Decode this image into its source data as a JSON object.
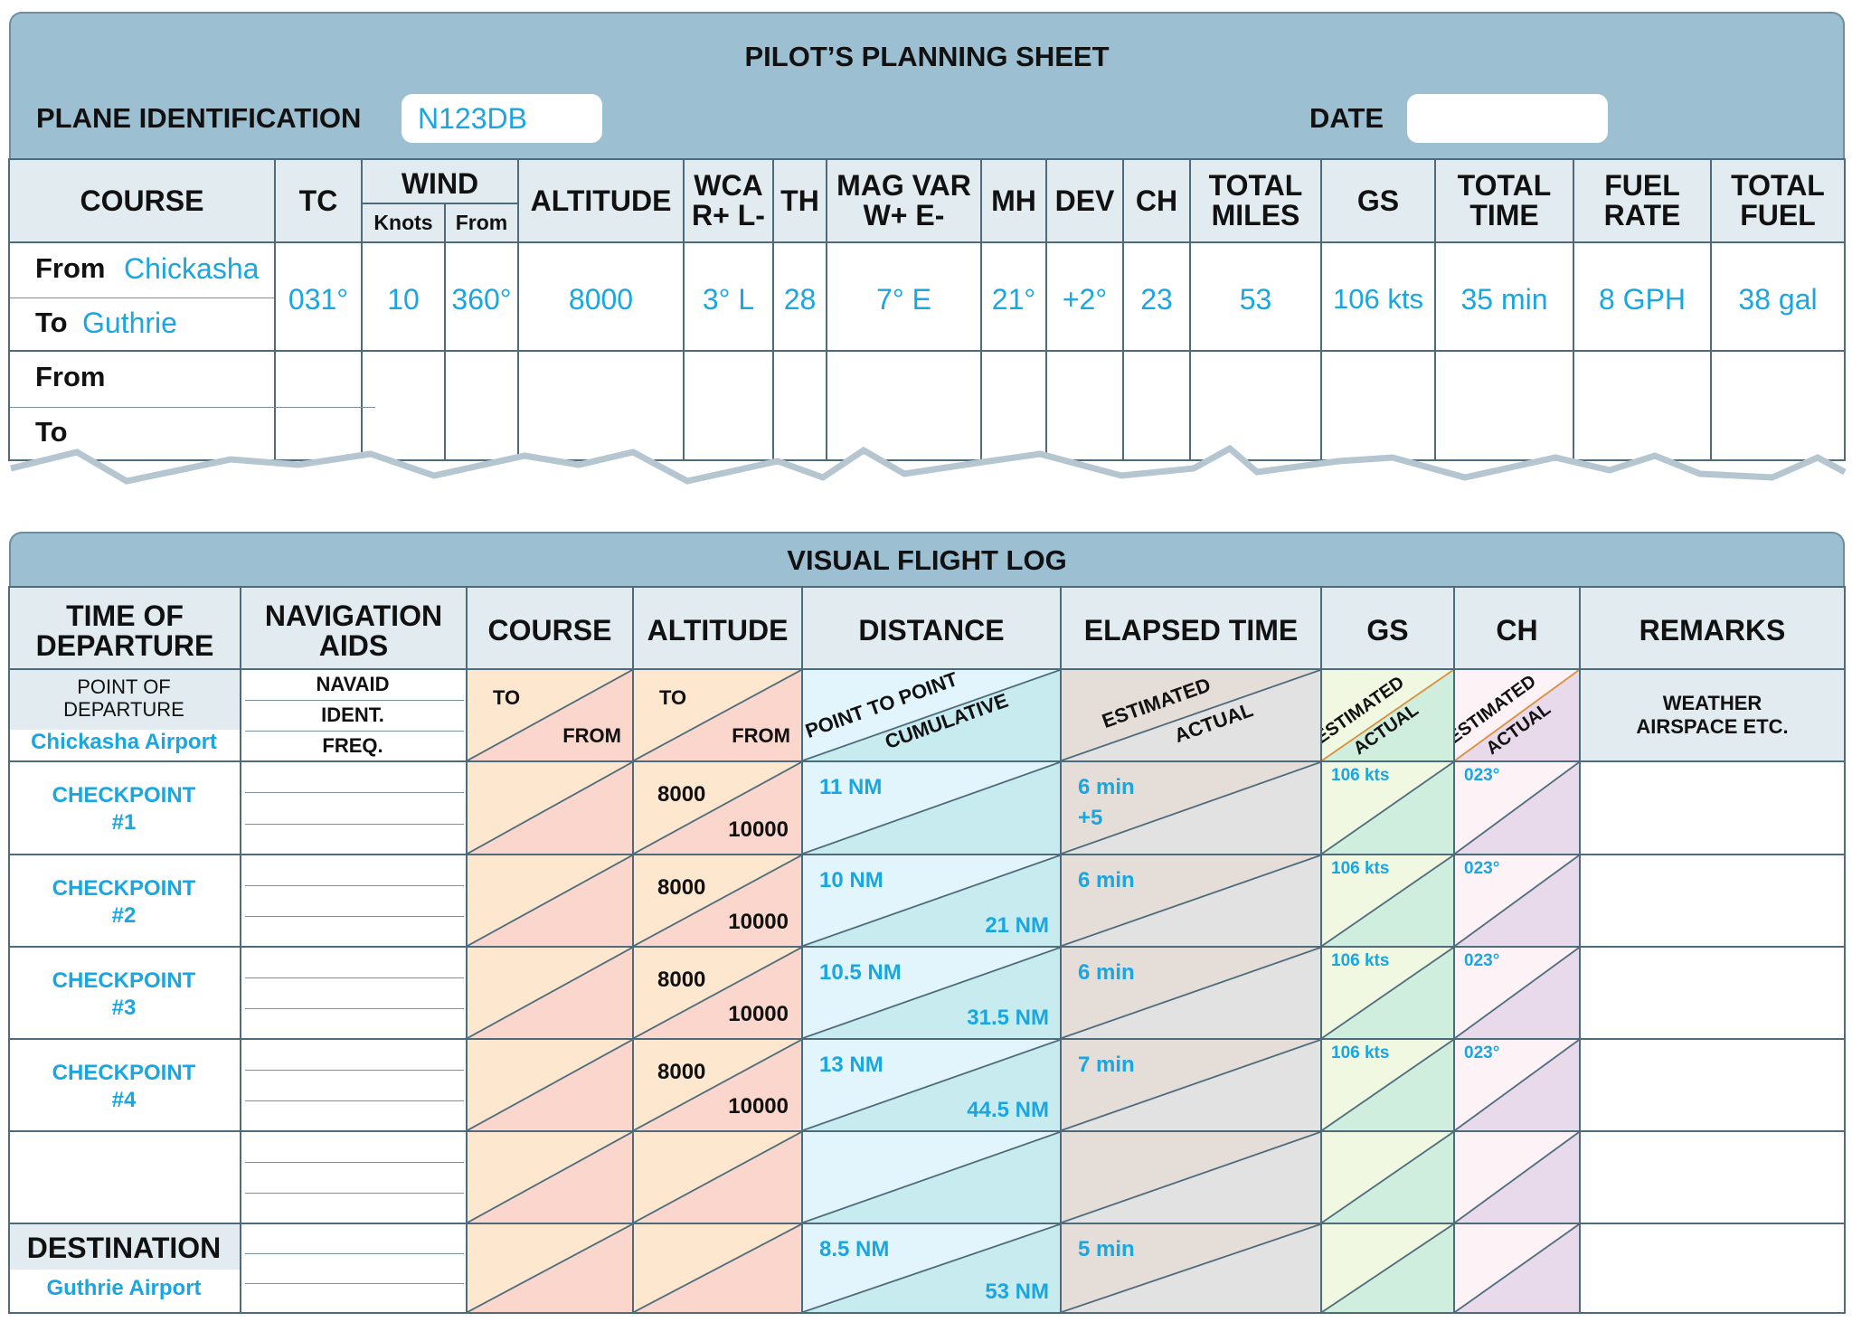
{
  "planning": {
    "title": "PILOT’S PLANNING SHEET",
    "plane_id_label": "PLANE IDENTIFICATION",
    "plane_id_value": "N123DB",
    "date_label": "DATE",
    "date_value": "",
    "headers": {
      "course": "COURSE",
      "tc": "TC",
      "wind": "WIND",
      "wind_knots": "Knots",
      "wind_from": "From",
      "altitude": "ALTITUDE",
      "wca": "WCA\nR+ L-",
      "th": "TH",
      "mag_var": "MAG VAR\nW+ E-",
      "mh": "MH",
      "dev": "DEV",
      "ch": "CH",
      "total_miles": "TOTAL\nMILES",
      "gs": "GS",
      "total_time": "TOTAL\nTIME",
      "fuel_rate": "FUEL\nRATE",
      "total_fuel": "TOTAL\nFUEL"
    },
    "legs": [
      {
        "from_label": "From",
        "from": "Chickasha",
        "to_label": "To",
        "to": "Guthrie",
        "tc": "031°",
        "wind_knots": "10",
        "wind_from": "360°",
        "altitude": "8000",
        "wca": "3° L",
        "th": "28",
        "mag_var": "7° E",
        "mh": "21°",
        "dev": "+2°",
        "ch": "23",
        "total_miles": "53",
        "gs": "106 kts",
        "total_time": "35 min",
        "fuel_rate": "8 GPH",
        "total_fuel": "38 gal"
      },
      {
        "from_label": "From",
        "from": "",
        "to_label": "To",
        "to": "",
        "tc": "",
        "wind_knots": "",
        "wind_from": "",
        "altitude": "",
        "wca": "",
        "th": "",
        "mag_var": "",
        "mh": "",
        "dev": "",
        "ch": "",
        "total_miles": "",
        "gs": "",
        "total_time": "",
        "fuel_rate": "",
        "total_fuel": ""
      }
    ]
  },
  "log": {
    "title": "VISUAL FLIGHT LOG",
    "headers": [
      "TIME OF\nDEPARTURE",
      "NAVIGATION\nAIDS",
      "COURSE",
      "ALTITUDE",
      "DISTANCE",
      "ELAPSED TIME",
      "GS",
      "CH",
      "REMARKS"
    ],
    "sub": {
      "departure_label": "POINT OF\nDEPARTURE",
      "departure_airport": "Chickasha Airport",
      "navaid": "NAVAID",
      "ident": "IDENT.",
      "freq": "FREQ.",
      "course_to": "TO",
      "course_from": "FROM",
      "alt_to": "TO",
      "alt_from": "FROM",
      "dist_ptp": "POINT TO POINT",
      "dist_cum": "CUMULATIVE",
      "et_est": "ESTIMATED",
      "et_act": "ACTUAL",
      "gs_est": "ESTIMATED",
      "gs_act": "ACTUAL",
      "ch_est": "ESTIMATED",
      "ch_act": "ACTUAL",
      "remarks": "WEATHER\nAIRSPACE ETC."
    },
    "rows": [
      {
        "name": "CHECKPOINT\n#1",
        "alt_to": "8000",
        "alt_from": "10000",
        "dist_ptp": "11 NM",
        "dist_cum": "",
        "et_est": "6 min",
        "et_act": "+5",
        "gs": "106 kts",
        "ch": "023°"
      },
      {
        "name": "CHECKPOINT\n#2",
        "alt_to": "8000",
        "alt_from": "10000",
        "dist_ptp": "10 NM",
        "dist_cum": "21 NM",
        "et_est": "6 min",
        "et_act": "",
        "gs": "106 kts",
        "ch": "023°"
      },
      {
        "name": "CHECKPOINT\n#3",
        "alt_to": "8000",
        "alt_from": "10000",
        "dist_ptp": "10.5 NM",
        "dist_cum": "31.5 NM",
        "et_est": "6 min",
        "et_act": "",
        "gs": "106 kts",
        "ch": "023°"
      },
      {
        "name": "CHECKPOINT\n#4",
        "alt_to": "8000",
        "alt_from": "10000",
        "dist_ptp": "13 NM",
        "dist_cum": "44.5 NM",
        "et_est": "7 min",
        "et_act": "",
        "gs": "106 kts",
        "ch": "023°"
      },
      {
        "name": "",
        "alt_to": "",
        "alt_from": "",
        "dist_ptp": "",
        "dist_cum": "",
        "et_est": "",
        "et_act": "",
        "gs": "",
        "ch": ""
      }
    ],
    "destination": {
      "label": "DESTINATION",
      "airport": "Guthrie Airport",
      "dist_ptp": "8.5 NM",
      "dist_cum": "53 NM",
      "et_est": "5 min"
    }
  },
  "colors": {
    "panel": "#9dbfd2",
    "header_cell": "#e1ebf0",
    "value_text": "#1aa6e0",
    "border": "#4d6b7b",
    "course_upper": "#fde7cf",
    "course_lower": "#fad6cc",
    "distance_upper": "#e3f5fc",
    "distance_lower": "#c8ebef",
    "elapsed_upper": "#e4ddd8",
    "elapsed_lower": "#e2e2e2",
    "gs_upper": "#f1f8e2",
    "gs_lower": "#cfeedd",
    "ch_upper": "#fdf2f6",
    "ch_lower": "#e8d9eb"
  }
}
